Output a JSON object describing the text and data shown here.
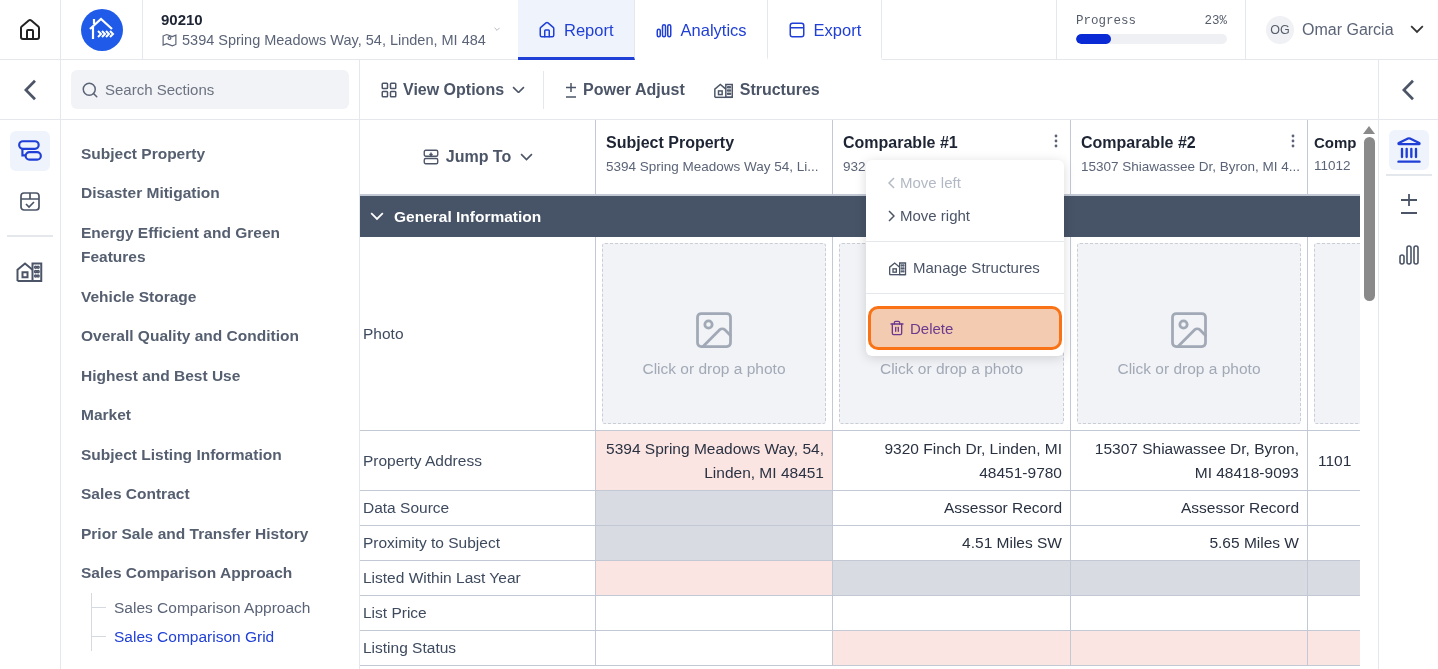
{
  "topbar": {
    "code": "90210",
    "address": "5394 Spring Meadows Way, 54, Linden, MI 484",
    "tabs": [
      {
        "kind": "report",
        "label": "Report",
        "selected": true
      },
      {
        "kind": "analytics",
        "label": "Analytics",
        "selected": false
      },
      {
        "kind": "export",
        "label": "Export",
        "selected": false
      }
    ],
    "progress": {
      "label": "Progress",
      "reading": "23%",
      "level": 0.23
    },
    "user": {
      "initials": "OG",
      "name": "Omar Garcia"
    }
  },
  "left_rail": [
    {
      "kind": "sections",
      "selected": true
    },
    {
      "kind": "checklist",
      "selected": false
    },
    {
      "kind": "structures",
      "selected": false
    }
  ],
  "sidebar": {
    "search": {
      "placeholder": "Search Sections"
    },
    "items": [
      {
        "label": "Subject Property",
        "selected": false
      },
      {
        "label": "Disaster Mitigation",
        "selected": false
      },
      {
        "label": "Energy Efficient and Green Features",
        "selected": false
      },
      {
        "label": "Vehicle Storage",
        "selected": false
      },
      {
        "label": "Overall Quality and Condition",
        "selected": false
      },
      {
        "label": "Highest and Best Use",
        "selected": false
      },
      {
        "label": "Market",
        "selected": false
      },
      {
        "label": "Subject Listing Information",
        "selected": false
      },
      {
        "label": "Sales Contract",
        "selected": false
      },
      {
        "label": "Prior Sale and Transfer History",
        "selected": false
      },
      {
        "label": "Sales Comparison Approach",
        "selected": false,
        "children": [
          {
            "label": "Sales Comparison Approach",
            "selected": false
          },
          {
            "label": "Sales Comparison Grid",
            "selected": true
          }
        ]
      }
    ]
  },
  "toolbar": [
    {
      "kind": "view",
      "label": "View Options"
    },
    {
      "kind": "adjust",
      "label": "Power Adjust"
    },
    {
      "kind": "structures",
      "label": "Structures"
    }
  ],
  "grid": {
    "jump_to": "Jump To",
    "columns": [
      {
        "title": "Subject Property",
        "subtitle": "5394 Spring Meadows Way 54, Li...",
        "menu": false
      },
      {
        "title": "Comparable #1",
        "subtitle": "932",
        "menu": true
      },
      {
        "title": "Comparable #2",
        "subtitle": "15307 Shiawassee Dr, Byron, MI 4...",
        "menu": true
      },
      {
        "title": "Comp",
        "subtitle": "11012",
        "menu": false
      }
    ],
    "section": {
      "title": "General Information",
      "expanded": true
    },
    "photo_row": {
      "label": "Photo",
      "placeholders": [
        "Click or drop a photo",
        "Click or drop a photo",
        "Click or drop a photo"
      ]
    },
    "rows": [
      {
        "label": "Property Address",
        "cells": [
          {
            "text": "5394 Spring Meadows Way, 54, Linden, MI 48451",
            "flagged": true,
            "na": false
          },
          {
            "text": "9320 Finch Dr, Linden, MI 48451-9780",
            "flagged": false,
            "na": false
          },
          {
            "text": "15307 Shiawassee Dr, Byron, MI 48418-9093",
            "flagged": false,
            "na": false
          },
          {
            "text": "1101",
            "flagged": false,
            "na": false
          }
        ]
      },
      {
        "label": "Data Source",
        "cells": [
          {
            "flagged": false,
            "na": true
          },
          {
            "text": "Assessor Record",
            "flagged": false,
            "na": false
          },
          {
            "text": "Assessor Record",
            "flagged": false,
            "na": false
          },
          {
            "flagged": false,
            "na": false
          }
        ]
      },
      {
        "label": "Proximity to Subject",
        "cells": [
          {
            "flagged": false,
            "na": true
          },
          {
            "text": "4.51 Miles SW",
            "flagged": false,
            "na": false
          },
          {
            "text": "5.65 Miles W",
            "flagged": false,
            "na": false
          },
          {
            "flagged": false,
            "na": false
          }
        ]
      },
      {
        "label": "Listed Within Last Year",
        "cells": [
          {
            "flagged": true,
            "na": false
          },
          {
            "flagged": false,
            "na": true
          },
          {
            "flagged": false,
            "na": true
          },
          {
            "flagged": false,
            "na": true
          }
        ]
      },
      {
        "label": "List Price",
        "cells": [
          {
            "flagged": false,
            "na": false
          },
          {
            "flagged": false,
            "na": false
          },
          {
            "flagged": false,
            "na": false
          },
          {
            "flagged": false,
            "na": false
          }
        ]
      },
      {
        "label": "Listing Status",
        "cells": [
          {
            "flagged": false,
            "na": false
          },
          {
            "flagged": true,
            "na": false
          },
          {
            "flagged": true,
            "na": false
          },
          {
            "flagged": true,
            "na": false
          }
        ]
      }
    ]
  },
  "context_menu": {
    "items": [
      {
        "kind": "back",
        "label": "Move left",
        "disabled": true,
        "highlighted": false
      },
      {
        "kind": "forward",
        "label": "Move right",
        "disabled": false,
        "highlighted": false
      },
      {
        "kind": "structures",
        "label": "Manage Structures",
        "disabled": false,
        "highlighted": false
      },
      {
        "kind": "delete",
        "label": "Delete",
        "disabled": false,
        "highlighted": true
      }
    ]
  },
  "right_rail": [
    {
      "kind": "appraisal",
      "selected": true
    },
    {
      "kind": "adjust",
      "selected": false
    },
    {
      "kind": "chart",
      "selected": false
    }
  ]
}
